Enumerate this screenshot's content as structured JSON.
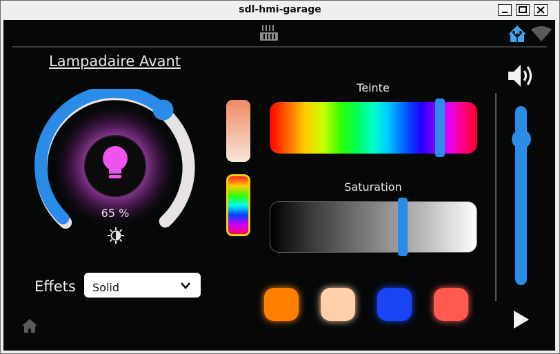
{
  "window": {
    "title": "sdl-hmi-garage"
  },
  "header": {
    "center_icon": "radiator-icon",
    "right_icons": [
      "home-assistant-icon",
      "wifi-icon"
    ]
  },
  "lamp": {
    "title": "Lampadaire Avant",
    "brightness": "65 %",
    "brightness_fraction": 0.65,
    "bulb_color": "#ee55ee",
    "icon": "lightbulb-icon",
    "brightness_icon": "brightness-icon"
  },
  "hue": {
    "label": "Teinte",
    "value_fraction": 0.82
  },
  "saturation": {
    "label": "Saturation",
    "value_fraction": 0.64
  },
  "effects": {
    "label": "Effets",
    "selected": "Solid"
  },
  "presets": [
    "#ff8000",
    "#ffd0aa",
    "#1a45f5",
    "#ff5a4f"
  ],
  "volume": {
    "level_fraction": 0.8,
    "icon": "volume-icon",
    "play_icon": "play-icon"
  },
  "footer": {
    "home_icon": "home-icon"
  }
}
